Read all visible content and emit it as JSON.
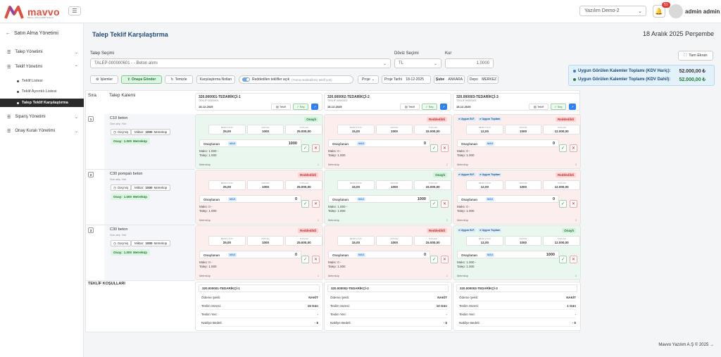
{
  "app": {
    "logo_text": "mavvo",
    "logo_sub": "Mavvo Yazılım ERP Sistemi"
  },
  "topbar": {
    "company": "Yazılım Demo-2",
    "notif_count": "51",
    "user": "admin admin"
  },
  "sidebar": {
    "back_label": "Satın Alma Yönetimi",
    "items": [
      {
        "label": "Talep Yönetimi"
      },
      {
        "label": "Teklif Yönetimi"
      },
      {
        "label": "Sipariş Yönetimi"
      },
      {
        "label": "Onay Kuralı Yönetimi"
      }
    ],
    "subitems": [
      {
        "label": "Teklif Listesi"
      },
      {
        "label": "Teklif Ayrıntılı Listesi"
      },
      {
        "label": "Talep Teklif Karşılaştırma"
      }
    ]
  },
  "page": {
    "title": "Talep Teklif Karşılaştırma",
    "date": "18 Aralık 2025 Perşembe"
  },
  "form": {
    "talep_label": "Talep Seçimi",
    "talep_value": "TALEP-000000601 - - Beton alımı",
    "doviz_label": "Döviz Seçimi",
    "doviz_value": "TL",
    "kur_label": "Kur",
    "kur_value": "1,0000",
    "fullscreen": "Tam Ekran"
  },
  "toolbar": {
    "islemler": "İşlemler",
    "onaya": "Onaya Gönder",
    "temizle": "Temizle",
    "notlar": "Karşılaştırma Notları",
    "toggle": "Reddedilen teklifler açık",
    "toggle_sub": "(Tümü reddedilmiş teklif yok)",
    "proje": "Proje",
    "proje_tarihi_label": "Proje Tarihi",
    "proje_tarihi": "18-12-2025",
    "sube_label": "Şube",
    "sube": "ANKARA",
    "depo_label": "Depo",
    "depo": "MERKEZ"
  },
  "totals": {
    "haric_label": "Uygun Görülen Kalemler Toplamı (KDV Hariç):",
    "haric_value": "52.000,00 ₺",
    "dahil_label": "Uygun Görülen Kalemler Toplamı (KDV Dahil):",
    "dahil_value": "52.000,00 ₺"
  },
  "grid": {
    "sira": "Sıra",
    "talep_kalemi": "Talep Kalemi",
    "kolonlar": [
      {
        "name": "320.000001-TEDARİKÇİ-1",
        "sub": "TEKLİF 00000001",
        "date": "18-12-2025"
      },
      {
        "name": "320.000002-TEDARİKÇİ-2",
        "sub": "TEKLİF 00000002",
        "date": "18-12-2025"
      },
      {
        "name": "320.000003-TEDARİKÇİ-3",
        "sub": "TEKLİF 00000003",
        "date": "18-12-2025"
      }
    ],
    "btn_teklif": "Teklif",
    "btn_sec": "✓ Seç",
    "box_labels": [
      "BİRİM FİYAT",
      "MİKTAR",
      "TOPLAM"
    ],
    "onaylanan": "Onaylanan",
    "max": "MAX",
    "tag_bf": "● Uygun B.F.",
    "tag_top": "● Uygun Toplam",
    "rows": [
      {
        "num": "1",
        "name": "C10 beton",
        "sub": "Son alış: Yok",
        "gecmis": "Geçmiş",
        "miktar_label": "Miktar:",
        "miktar": "1000",
        "unit": "Metreküp",
        "onay_label": "Onay:",
        "onay": "1.000",
        "onay_unit": "Metreküp",
        "cells": [
          {
            "status": "Onaylı",
            "bf": "25,00",
            "m": "1000",
            "t": "25.000,00",
            "on": "1000",
            "maks": "Maks: 1.000 -",
            "talep": "Talep: 1.000",
            "unit": "Metreküp",
            "idx": "1"
          },
          {
            "status": "Reddedildi",
            "bf": "15,00",
            "m": "1000",
            "t": "15.000,00",
            "on": "0",
            "maks": "Maks: 0 -",
            "talep": "Talep: 1.000",
            "unit": "Metreküp",
            "idx": "2"
          },
          {
            "status": "Reddedildi",
            "bf": "12,00",
            "m": "1000",
            "t": "12.000,00",
            "on": "0",
            "maks": "Maks: 0 -",
            "talep": "Talep: 1.000",
            "unit": "Metreküp",
            "idx": "3"
          }
        ]
      },
      {
        "num": "2",
        "name": "C30 pompalı beton",
        "sub": "Son alış: Yok",
        "gecmis": "Geçmiş",
        "miktar_label": "Miktar:",
        "miktar": "1000",
        "unit": "Metreküp",
        "onay_label": "Onay:",
        "onay": "1.000",
        "onay_unit": "Metreküp",
        "cells": [
          {
            "status": "Reddedildi",
            "bf": "25,00",
            "m": "1000",
            "t": "25.000,00",
            "on": "0",
            "maks": "Maks: 0 -",
            "talep": "Talep: 1.000",
            "unit": "Metreküp",
            "idx": "1"
          },
          {
            "status": "Onaylı",
            "bf": "15,00",
            "m": "1000",
            "t": "15.000,00",
            "on": "1000",
            "maks": "Maks: 1.000 -",
            "talep": "Talep: 1.000",
            "unit": "Metreküp",
            "idx": "2"
          },
          {
            "status": "Reddedildi",
            "bf": "12,00",
            "m": "1000",
            "t": "12.000,00",
            "on": "0",
            "maks": "Maks: 0 -",
            "talep": "Talep: 1.000",
            "unit": "Metreküp",
            "idx": "3"
          }
        ]
      },
      {
        "num": "3",
        "name": "C30 beton",
        "sub": "Son alış: Yok",
        "gecmis": "Geçmiş",
        "miktar_label": "Miktar:",
        "miktar": "1000",
        "unit": "Metreküp",
        "onay_label": "Onay:",
        "onay": "1.000",
        "onay_unit": "Metreküp",
        "cells": [
          {
            "status": "Reddedildi",
            "bf": "25,00",
            "m": "1000",
            "t": "25.000,00",
            "on": "0",
            "maks": "Maks: 0 -",
            "talep": "Talep: 1.000",
            "unit": "Metreküp",
            "idx": "1"
          },
          {
            "status": "Reddedildi",
            "bf": "15,00",
            "m": "1000",
            "t": "15.000,00",
            "on": "0",
            "maks": "Maks: 0 -",
            "talep": "Talep: 1.000",
            "unit": "Metreküp",
            "idx": "2"
          },
          {
            "status": "Onaylı",
            "bf": "12,00",
            "m": "1000",
            "t": "12.000,00",
            "on": "1000",
            "maks": "Maks: 1.000 -",
            "talep": "Talep: 1.000",
            "unit": "Metreküp",
            "idx": "3"
          }
        ]
      }
    ],
    "teklif_kosullari": "TEKLİF KOŞULLARI",
    "kosul_labels": [
      "Ödeme Şekli:",
      "Teslim Süresi:",
      "Teslim Yeri:",
      "Nakliye Bedeli:"
    ],
    "kosullar": [
      {
        "name": "320.000001-TEDARİKÇİ-1",
        "vals": [
          "NAKİT",
          "15 Gün",
          "-",
          "- $"
        ]
      },
      {
        "name": "320.000002-TEDARİKÇİ-2",
        "vals": [
          "NAKİT",
          "10 Gün",
          "-",
          "- $"
        ]
      },
      {
        "name": "320.000003-TEDARİKÇİ-3",
        "vals": [
          "NAKİT",
          "1 Gün",
          "-",
          "- $"
        ]
      }
    ]
  },
  "footer": "Mavvo Yazılım A.Ş © 2025 →"
}
